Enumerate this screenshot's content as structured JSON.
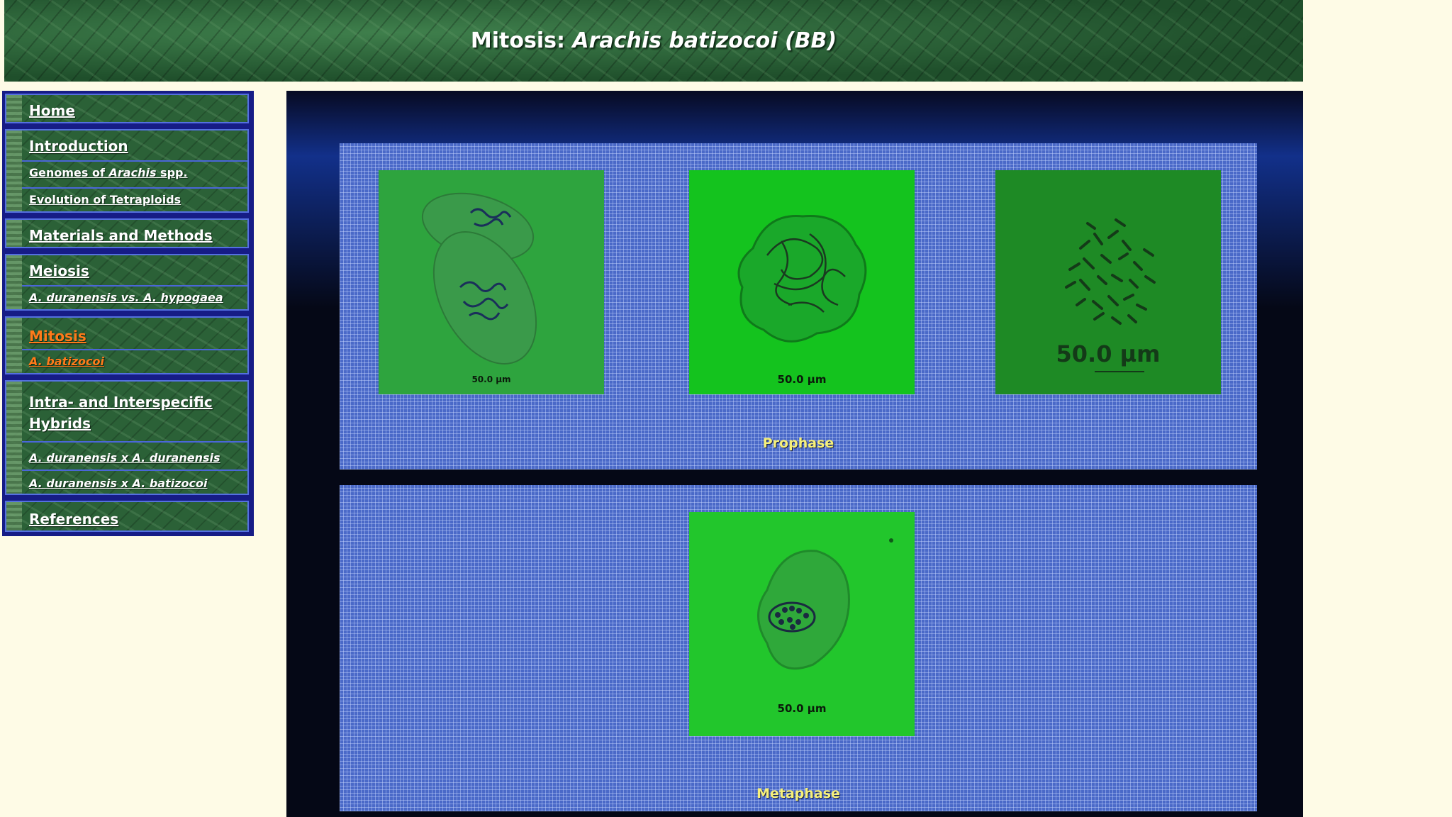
{
  "header": {
    "title_prefix": "Mitosis: ",
    "title_species": "Arachis batizocoi (BB)"
  },
  "sidebar": {
    "home": "Home",
    "introduction": "Introduction",
    "genomes_prefix": "Genomes of ",
    "genomes_genus": "Arachis",
    "genomes_suffix": " spp.",
    "evolution": "Evolution of Tetraploids",
    "materials": "Materials and Methods",
    "meiosis": "Meiosis",
    "meiosis_sub": "A. duranensis vs. A. hypogaea",
    "mitosis": "Mitosis",
    "mitosis_sub": "A. batizocoi",
    "hybrids_line1": "Intra- and Interspecific",
    "hybrids_line2": "Hybrids",
    "hybrid_1": "A. duranensis x A. duranensis",
    "hybrid_2": "A. duranensis x A. batizocoi",
    "references": "References"
  },
  "colors": {
    "active_link": "#ff7a1a",
    "stage_label": "#f6f07a",
    "page_background": "#fefbe6"
  },
  "content": {
    "prophase": {
      "label": "Prophase",
      "images": [
        {
          "icon": "cell-micrograph-icon",
          "scale": "50.0 µm"
        },
        {
          "icon": "cell-micrograph-icon",
          "scale": "50.0 µm"
        },
        {
          "icon": "chromosome-spread-icon",
          "scale": "50.0 µm"
        }
      ]
    },
    "metaphase": {
      "label": "Metaphase",
      "images": [
        {
          "icon": "cell-micrograph-icon",
          "scale": "50.0 µm"
        }
      ]
    }
  }
}
